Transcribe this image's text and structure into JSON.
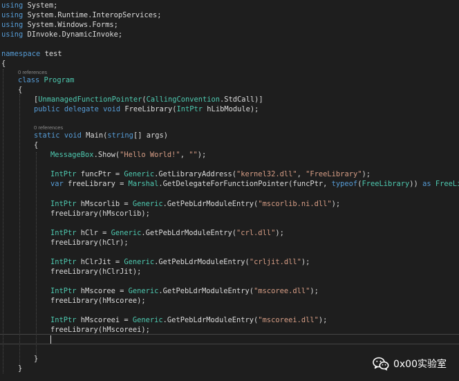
{
  "code": {
    "usings": [
      [
        "using",
        " System;"
      ],
      [
        "using",
        " System.Runtime.InteropServices;"
      ],
      [
        "using",
        " System.Windows.Forms;"
      ],
      [
        "using",
        " DInvoke.DynamicInvoke;"
      ]
    ],
    "namespace_kw": "namespace",
    "namespace_name": " test",
    "open_brace": "{",
    "close_brace": "}",
    "refs_label": "0 references",
    "class_kw": "class",
    "class_name": "Program",
    "attr_open": "[",
    "attr_name": "UnmanagedFunctionPointer",
    "attr_mid": "(",
    "attr_arg_type": "CallingConvention",
    "attr_arg_rest": ".StdCall)]",
    "delegate_public": "public",
    "delegate_kw": "delegate",
    "void_kw": "void",
    "delegate_name": "FreeLibrary(",
    "intptr": "IntPtr",
    "delegate_param": " hLibModule);",
    "static_kw": "static",
    "main_name": "Main(",
    "string_kw": "string",
    "main_params": "[] args)",
    "msgbox_type": "MessageBox",
    "msgbox_call": ".Show(",
    "msgbox_str1": "\"Hello World!\"",
    "comma": ", ",
    "msgbox_str2": "\"\"",
    "call_close": ");",
    "funcptr_decl": " funcPtr = ",
    "generic": "Generic",
    "get_lib_addr": ".GetLibraryAddress(",
    "kernel32": "\"kernel32.dll\"",
    "freelib_str": "\"FreeLibrary\"",
    "var_kw": "var",
    "freelib_decl": " freeLibrary = ",
    "marshal": "Marshal",
    "get_delegate": ".GetDelegateForFunctionPointer(funcPtr, ",
    "typeof_kw": "typeof",
    "open_paren": "(",
    "freelib_type": "FreeLibrary",
    "close_parens": ")) ",
    "as_kw": "as",
    "space": " ",
    "get_peb": ".GetPebLdrModuleEntry(",
    "modules": [
      {
        "decl": " hMscorlib = ",
        "dll": "\"mscorlib.ni.dll\"",
        "call": "freeLibrary(hMscorlib);"
      },
      {
        "decl": " hClr = ",
        "dll": "\"crl.dll\"",
        "call": "freeLibrary(hClr);"
      },
      {
        "decl": " hClrJit = ",
        "dll": "\"crljit.dll\"",
        "call": "freeLibrary(hClrJit);"
      },
      {
        "decl": " hMscoree = ",
        "dll": "\"mscoree.dll\"",
        "call": "freeLibrary(hMscoree);"
      },
      {
        "decl": " hMscoreei = ",
        "dll": "\"mscoreei.dll\"",
        "call": "freeLibrary(hMscoreei);"
      }
    ]
  },
  "watermark": {
    "text": "0x00实验室",
    "icon": "wechat-icon"
  },
  "colors": {
    "background": "#1e1e1e",
    "keyword": "#569cd6",
    "type": "#4ec9b0",
    "string": "#d69d85",
    "text": "#dcdcdc"
  }
}
